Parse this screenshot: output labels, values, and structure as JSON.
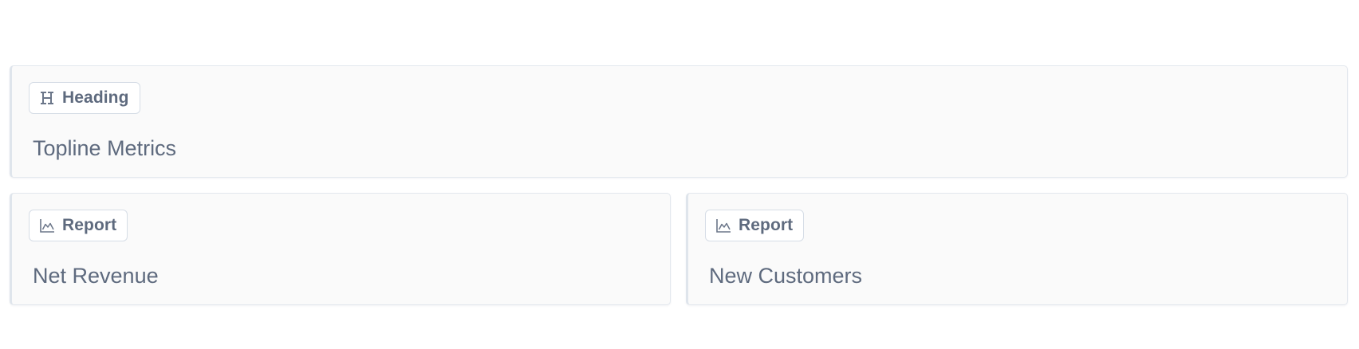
{
  "cards": [
    {
      "badge": {
        "label": "Heading",
        "icon": "heading-icon"
      },
      "title": "Topline Metrics"
    },
    {
      "badge": {
        "label": "Report",
        "icon": "area-chart-icon"
      },
      "title": "Net Revenue"
    },
    {
      "badge": {
        "label": "Report",
        "icon": "area-chart-icon"
      },
      "title": "New Customers"
    }
  ],
  "colors": {
    "text": "#5e6a7e",
    "card_background": "#fafafa",
    "card_border": "#e3e8ee",
    "badge_border": "#d6dde6",
    "page_background": "#ffffff"
  }
}
